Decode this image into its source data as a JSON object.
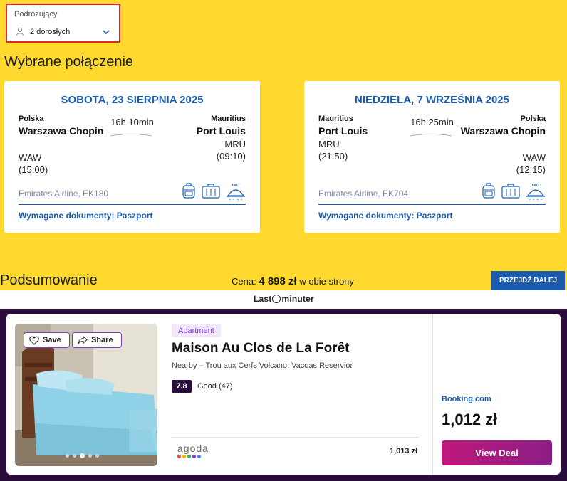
{
  "travellers": {
    "label": "Podróżujący",
    "value": "2 dorosłych"
  },
  "selected_title": "Wybrane połączenie",
  "flights": [
    {
      "date": "SOBOTA, 23 SIERPNIA 2025",
      "from_country": "Polska",
      "from_city": "Warszawa Chopin",
      "from_code": "WAW",
      "from_time": "(15:00)",
      "duration": "16h 10min",
      "to_country": "Mauritius",
      "to_city": "Port Louis",
      "to_code": "MRU",
      "to_time": "(09:10)",
      "airline": "Emirates Airline, EK180",
      "docs": "Wymagane dokumenty: Paszport"
    },
    {
      "date": "NIEDZIELA, 7 WRZEŚNIA 2025",
      "from_country": "Mauritius",
      "from_city": "Port Louis",
      "from_code": "MRU",
      "from_time": "(21:50)",
      "duration": "16h 25min",
      "to_country": "Polska",
      "to_city": "Warszawa Chopin",
      "to_code": "WAW",
      "to_time": "(12:15)",
      "airline": "Emirates Airline, EK704",
      "docs": "Wymagane dokumenty: Paszport"
    }
  ],
  "summary": {
    "title": "Podsumowanie",
    "price_label": "Cena:",
    "price_amount": "4 898 zł",
    "price_suffix": " w obie strony",
    "next_button": "PRZEJDŹ DALEJ"
  },
  "ad": {
    "brand_left": "Last",
    "brand_right": "minuter",
    "save_label": "Save",
    "share_label": "Share",
    "type": "Apartment",
    "name": "Maison Au Clos de La Forêt",
    "nearby": "Nearby – Trou aux Cerfs Volcano, Vacoas Reservior",
    "score": "7.8",
    "score_text": "Good (47)",
    "agoda_name": "agoda",
    "agoda_price": "1,013 zł",
    "booking_name": "Booking.com",
    "booking_price": "1,012 zł",
    "deal_button": "View Deal"
  },
  "colors": {
    "primary": "#1b5cae",
    "background": "#ffd92e",
    "ad_dark": "#2b0d3d",
    "deal_start": "#c0187a",
    "deal_end": "#8a1f86"
  }
}
